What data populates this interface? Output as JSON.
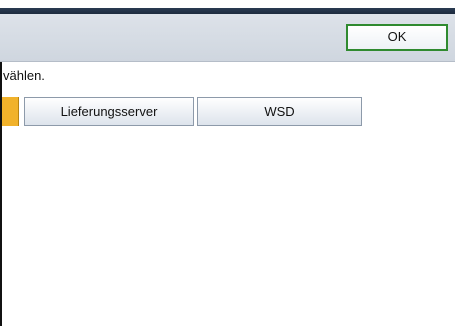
{
  "toolbar": {
    "ok_label": "OK"
  },
  "main": {
    "instruction_text": "vählen.",
    "options": [
      {
        "label": "Lieferungsserver"
      },
      {
        "label": "WSD"
      }
    ]
  },
  "colors": {
    "header_dark": "#1d2a3d",
    "ok_border": "#2f8a2f",
    "selected_accent": "#f1b22b"
  }
}
